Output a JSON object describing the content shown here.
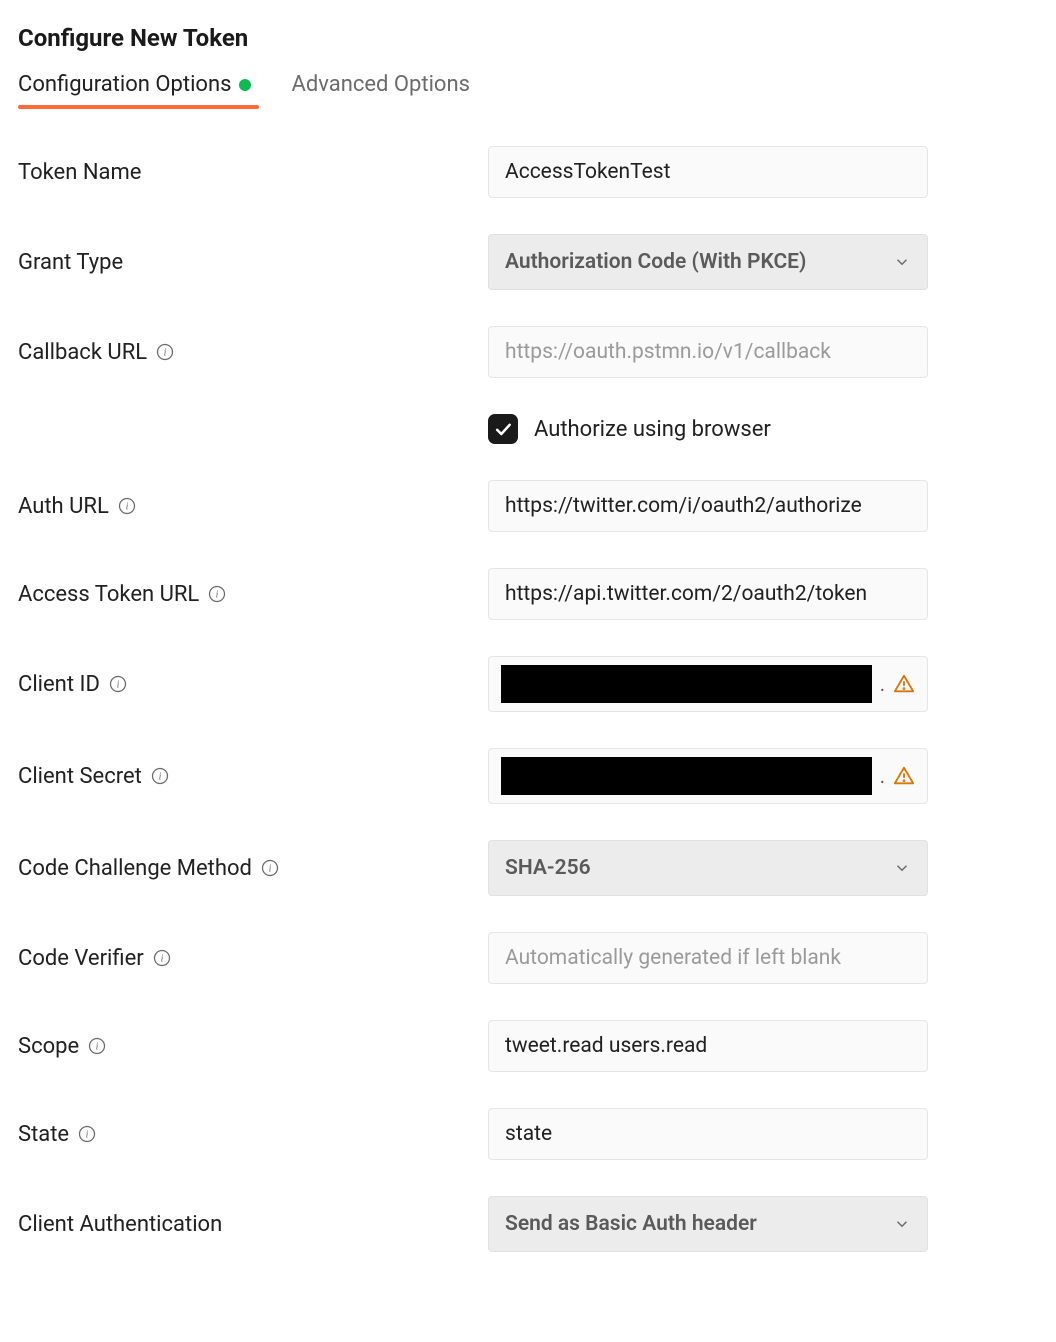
{
  "header": {
    "title": "Configure New Token"
  },
  "tabs": {
    "config": "Configuration Options",
    "advanced": "Advanced Options"
  },
  "fields": {
    "token_name": {
      "label": "Token Name",
      "value": "AccessTokenTest"
    },
    "grant_type": {
      "label": "Grant Type",
      "value": "Authorization Code (With PKCE)"
    },
    "callback_url": {
      "label": "Callback URL",
      "placeholder": "https://oauth.pstmn.io/v1/callback",
      "value": ""
    },
    "authorize_browser": {
      "label": "Authorize using browser",
      "checked": true
    },
    "auth_url": {
      "label": "Auth URL",
      "value": "https://twitter.com/i/oauth2/authorize"
    },
    "access_token_url": {
      "label": "Access Token URL",
      "value": "https://api.twitter.com/2/oauth2/token"
    },
    "client_id": {
      "label": "Client ID"
    },
    "client_secret": {
      "label": "Client Secret"
    },
    "code_challenge_method": {
      "label": "Code Challenge Method",
      "value": "SHA-256"
    },
    "code_verifier": {
      "label": "Code Verifier",
      "placeholder": "Automatically generated if left blank",
      "value": ""
    },
    "scope": {
      "label": "Scope",
      "value": "tweet.read users.read"
    },
    "state": {
      "label": "State",
      "value": "state"
    },
    "client_auth": {
      "label": "Client Authentication",
      "value": "Send as Basic Auth header"
    }
  }
}
